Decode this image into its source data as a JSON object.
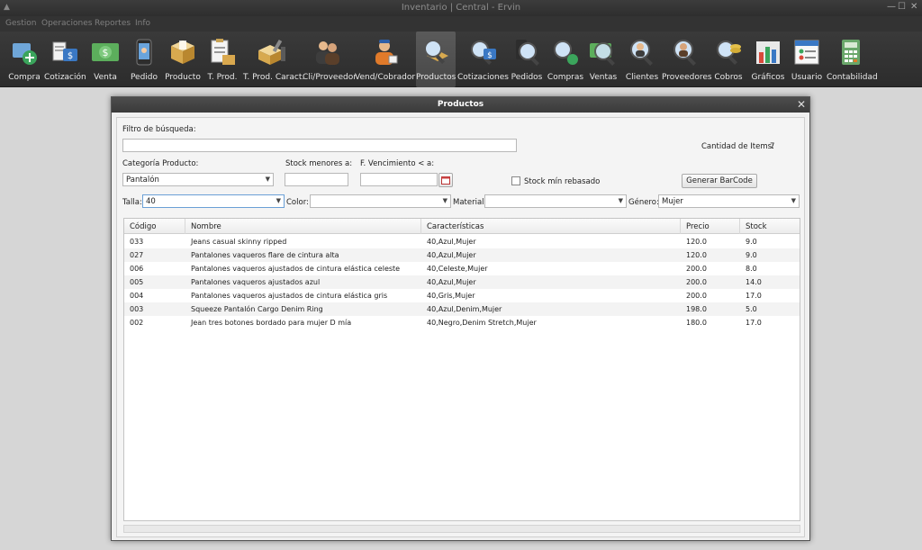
{
  "window": {
    "title": "Inventario | Central - Ervin",
    "minimize_glyph": "—",
    "maximize_glyph": "☐",
    "close_glyph": "✕"
  },
  "menu": [
    "Gestion",
    "Operaciones",
    "Reportes",
    "Info"
  ],
  "toolbar": [
    {
      "label": "Compra",
      "icon": "cart-add-icon"
    },
    {
      "label": "Cotización",
      "icon": "quote-money-icon"
    },
    {
      "label": "Venta",
      "icon": "money-bill-icon"
    },
    {
      "label": "Pedido",
      "icon": "order-phone-icon"
    },
    {
      "label": "Producto",
      "icon": "box-icon"
    },
    {
      "label": "T. Prod.",
      "icon": "clipboard-box-icon"
    },
    {
      "label": "T. Prod. Caract.",
      "icon": "box-tools-icon"
    },
    {
      "label": "Cli/Proveedor",
      "icon": "people-icon"
    },
    {
      "label": "Vend/Cobrador",
      "icon": "salesman-icon"
    },
    {
      "label": "Productos",
      "icon": "search-box-icon",
      "active": true
    },
    {
      "label": "Cotizaciones",
      "icon": "search-money-icon"
    },
    {
      "label": "Pedidos",
      "icon": "search-phone-icon"
    },
    {
      "label": "Compras",
      "icon": "search-cart-icon"
    },
    {
      "label": "Ventas",
      "icon": "search-bill-icon"
    },
    {
      "label": "Clientes",
      "icon": "search-person-icon"
    },
    {
      "label": "Proveedores",
      "icon": "search-provider-icon"
    },
    {
      "label": "Cobros",
      "icon": "search-coins-icon"
    },
    {
      "label": "Gráficos",
      "icon": "bar-chart-icon"
    },
    {
      "label": "Usuario",
      "icon": "user-card-icon"
    },
    {
      "label": "Contabilidad",
      "icon": "calculator-icon"
    }
  ],
  "dialog": {
    "title": "Productos",
    "close_glyph": "✕",
    "filter_label": "Filtro de búsqueda:",
    "filter_value": "",
    "count_label": "Cantidad de Items:",
    "count_value": "7",
    "category_label": "Categoría Producto:",
    "category_value": "Pantalón",
    "stock_label": "Stock menores a:",
    "stock_value": "",
    "expiry_label": "F. Vencimiento < a:",
    "expiry_value": "",
    "stock_min_label": "Stock mín rebasado",
    "barcode_button": "Generar BarCode",
    "talla_label": "Talla:",
    "talla_value": "40",
    "color_label": "Color:",
    "color_value": "",
    "material_label": "Material:",
    "material_value": "",
    "genero_label": "Género:",
    "genero_value": "Mujer",
    "combo_arrow": "▼"
  },
  "table": {
    "columns": [
      "Código",
      "Nombre",
      "Características",
      "Precio",
      "Stock"
    ],
    "rows": [
      [
        "033",
        "Jeans casual skinny ripped",
        "40,Azul,Mujer",
        "120.0",
        "9.0"
      ],
      [
        "027",
        "Pantalones vaqueros flare de cintura alta",
        "40,Azul,Mujer",
        "120.0",
        "9.0"
      ],
      [
        "006",
        "Pantalones vaqueros ajustados de cintura elástica celeste",
        "40,Celeste,Mujer",
        "200.0",
        "8.0"
      ],
      [
        "005",
        "Pantalones vaqueros ajustados azul",
        "40,Azul,Mujer",
        "200.0",
        "14.0"
      ],
      [
        "004",
        "Pantalones vaqueros ajustados de cintura elástica gris",
        "40,Gris,Mujer",
        "200.0",
        "17.0"
      ],
      [
        "003",
        "Squeeze Pantalón Cargo Denim Ring",
        "40,Azul,Denim,Mujer",
        "198.0",
        "5.0"
      ],
      [
        "002",
        "Jean tres botones bordado para mujer D mía",
        "40,Negro,Denim Stretch,Mujer",
        "180.0",
        "17.0"
      ]
    ]
  }
}
